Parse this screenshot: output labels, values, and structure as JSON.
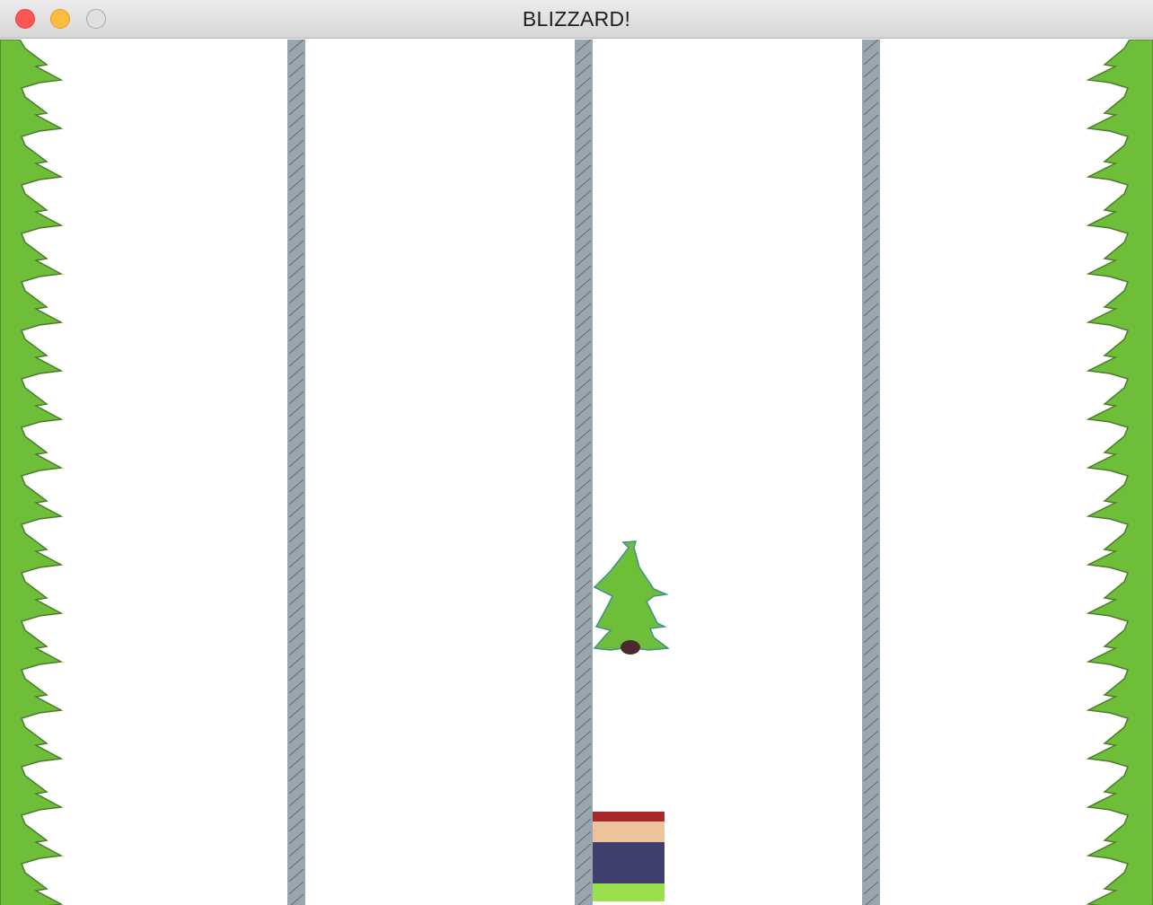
{
  "window": {
    "title": "BLIZZARD!",
    "buttons": {
      "close": "close-button",
      "minimize": "minimize-button",
      "zoom": "zoom-button"
    }
  },
  "game": {
    "lanes": 4,
    "player_lane": 3,
    "tree_lane": 3,
    "colors": {
      "background": "#ffffff",
      "forest_green": "#6fbe3a",
      "forest_outline": "#4a7d2a",
      "lane_divider": "#9aa6ae",
      "tree_trunk": "#4a2a2e",
      "hat": "#a8282c",
      "face": "#edc39c",
      "body": "#3f3f6e",
      "skis": "#9ae04e"
    },
    "icons": {
      "obstacle": "pine-tree-icon",
      "player": "skier-icon"
    }
  }
}
